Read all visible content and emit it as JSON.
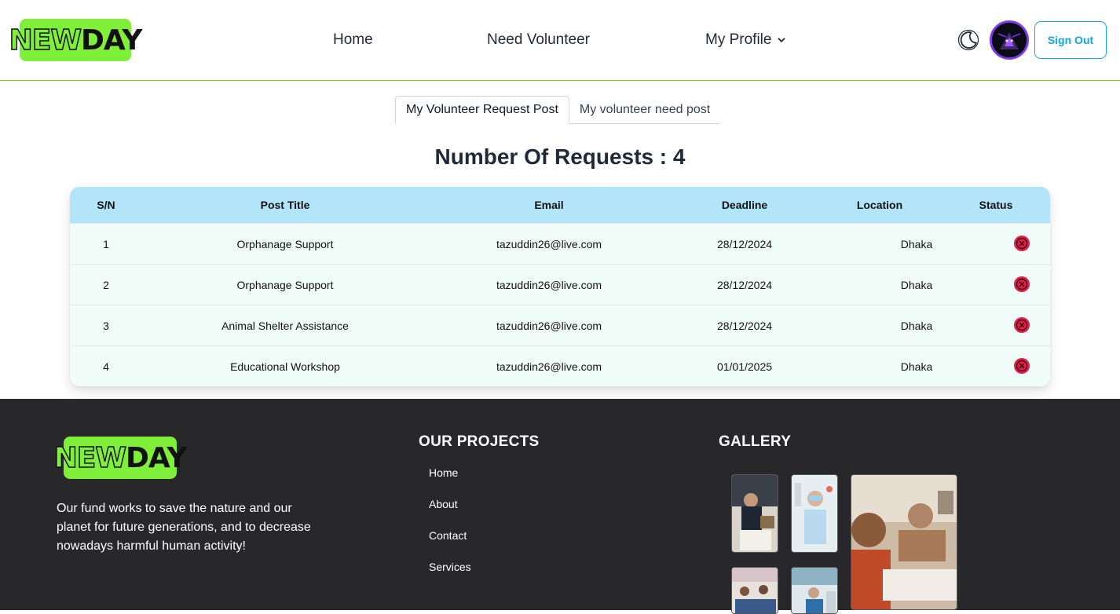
{
  "brand": {
    "logo_part1": "NEW",
    "logo_part2": "DAY"
  },
  "nav": {
    "home": "Home",
    "need_volunteer": "Need Volunteer",
    "my_profile": "My Profile",
    "sign_out": "Sign Out"
  },
  "tabs": [
    {
      "label": "My Volunteer Request Post",
      "active": true
    },
    {
      "label": "My volunteer need post",
      "active": false
    }
  ],
  "requests_title": "Number Of Requests : 4",
  "table": {
    "headers": [
      "S/N",
      "Post Title",
      "Email",
      "Deadline",
      "Location",
      "Status"
    ],
    "rows": [
      {
        "sn": "1",
        "title": "Orphanage Support",
        "email": "tazuddin26@live.com",
        "deadline": "28/12/2024",
        "location": "Dhaka",
        "status_icon": "cancel-icon"
      },
      {
        "sn": "2",
        "title": "Orphanage Support",
        "email": "tazuddin26@live.com",
        "deadline": "28/12/2024",
        "location": "Dhaka",
        "status_icon": "cancel-icon"
      },
      {
        "sn": "3",
        "title": "Animal Shelter Assistance",
        "email": "tazuddin26@live.com",
        "deadline": "28/12/2024",
        "location": "Dhaka",
        "status_icon": "cancel-icon"
      },
      {
        "sn": "4",
        "title": "Educational Workshop",
        "email": "tazuddin26@live.com",
        "deadline": "01/01/2025",
        "location": "Dhaka",
        "status_icon": "cancel-icon"
      }
    ]
  },
  "footer": {
    "description": "Our fund works to save the nature and our planet for future generations, and to decrease nowadays harmful human activity!",
    "projects_heading": "OUR PROJECTS",
    "links": [
      "Home",
      "About",
      "Contact",
      "Services"
    ],
    "gallery_heading": "GALLERY"
  },
  "colors": {
    "brand_green": "#7fef3a",
    "accent_blue": "#0ea5e9",
    "table_header": "#b3e5fa",
    "cancel_red": "#e11d48",
    "footer_bg": "#28282b"
  }
}
